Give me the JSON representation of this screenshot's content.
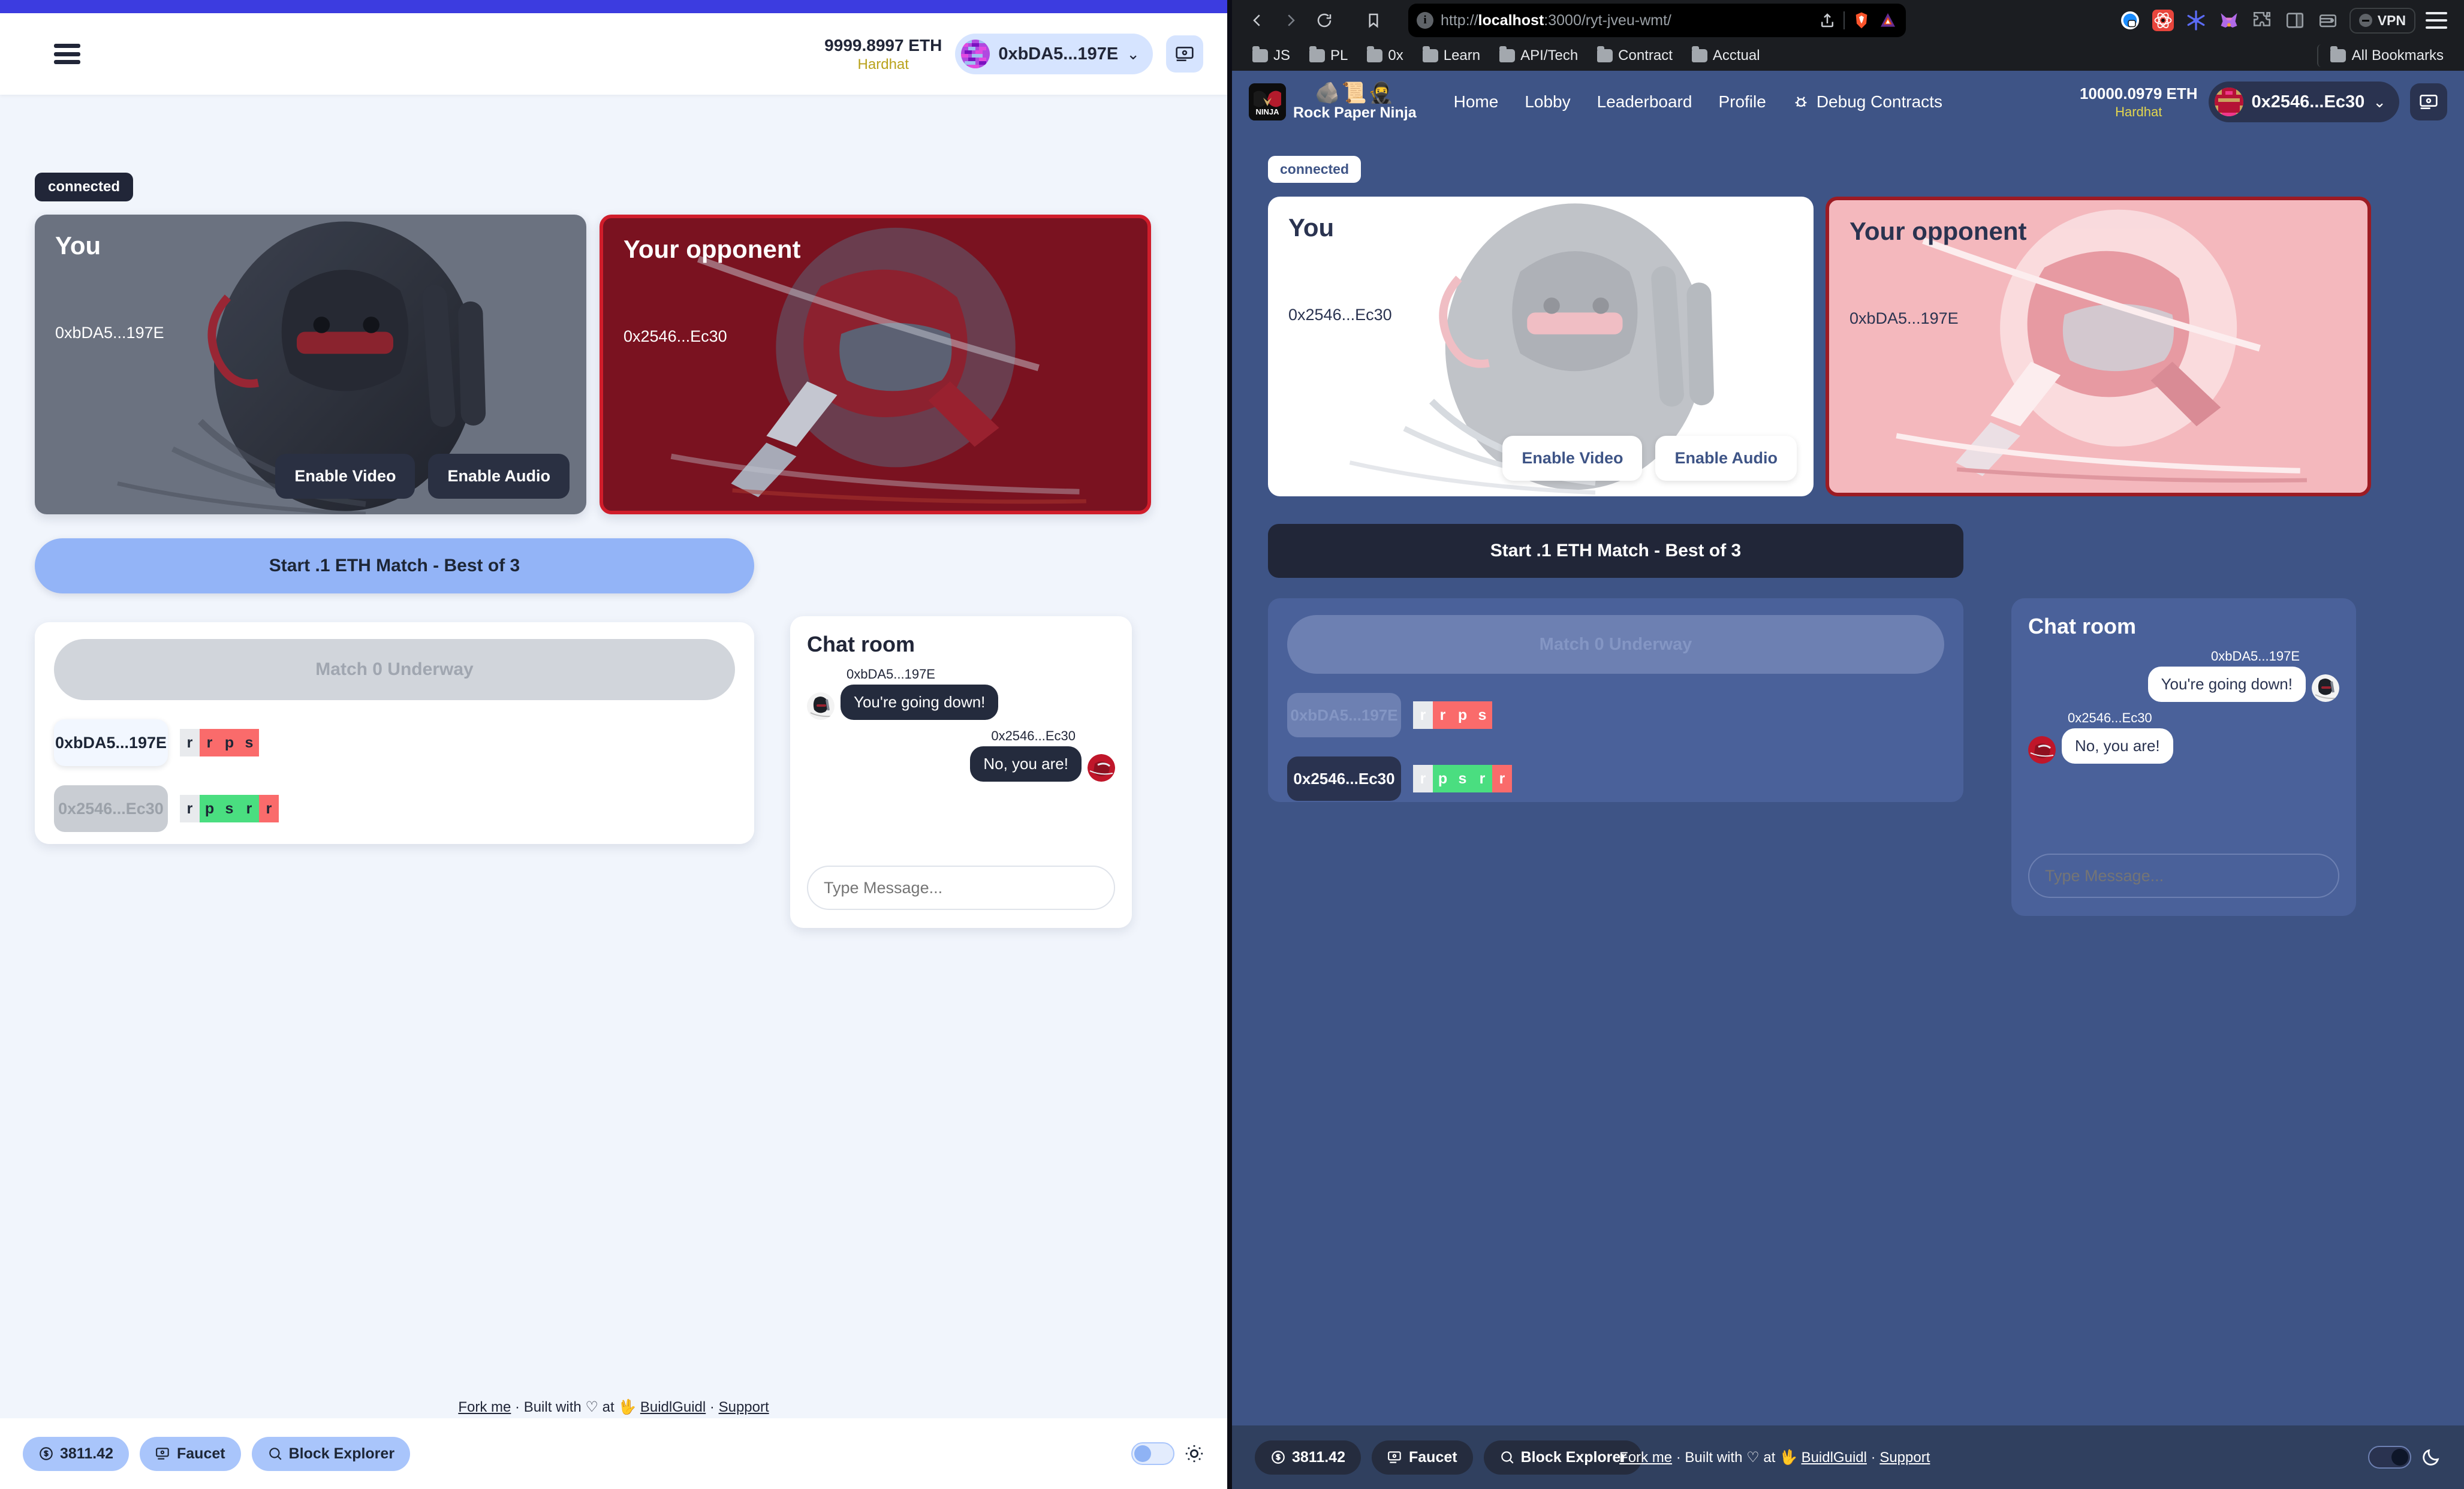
{
  "left_app": {
    "header": {
      "balance_eth": "9999.8997 ETH",
      "network": "Hardhat",
      "address": "0xbDA5...197E",
      "chevron": "chevron-down-icon",
      "menu_icon": "hamburger-menu-icon"
    },
    "status_badge": "connected",
    "you_card": {
      "title": "You",
      "address": "0xbDA5...197E",
      "enable_video": "Enable Video",
      "enable_audio": "Enable Audio"
    },
    "opponent_card": {
      "title": "Your opponent",
      "address": "0x2546...Ec30"
    },
    "start_button": "Start .1 ETH Match - Best of 3",
    "match": {
      "underway": "Match 0 Underway",
      "rows": [
        {
          "address": "0xbDA5...197E",
          "active": true,
          "moves": [
            {
              "m": "r",
              "state": "neutral"
            },
            {
              "m": "r",
              "state": "lose"
            },
            {
              "m": "p",
              "state": "lose"
            },
            {
              "m": "s",
              "state": "lose"
            }
          ]
        },
        {
          "address": "0x2546...Ec30",
          "active": false,
          "moves": [
            {
              "m": "r",
              "state": "neutral"
            },
            {
              "m": "p",
              "state": "win"
            },
            {
              "m": "s",
              "state": "win"
            },
            {
              "m": "r",
              "state": "win"
            },
            {
              "m": "r",
              "state": "lose"
            }
          ]
        }
      ]
    },
    "chat": {
      "title": "Chat room",
      "messages": [
        {
          "who": "0xbDA5...197E",
          "text": "You're going down!",
          "side": "left"
        },
        {
          "who": "0x2546...Ec30",
          "text": "No, you are!",
          "side": "right"
        }
      ],
      "input_placeholder": "Type Message..."
    },
    "footer": {
      "fork_me": "Fork me",
      "sep1": "·",
      "built_with": "Built with",
      "heart": "♡",
      "at": "at",
      "buidlguidl": "BuidlGuidl",
      "sep2": "·",
      "support": "Support",
      "price": "3811.42",
      "faucet": "Faucet",
      "block_explorer": "Block Explorer"
    }
  },
  "browser": {
    "back_icon": "back-arrow-icon",
    "forward_icon": "forward-arrow-icon",
    "reload_icon": "reload-icon",
    "bookmark_icon": "bookmark-icon",
    "url_prefix": "http://",
    "url_host": "localhost",
    "url_rest": ":3000/ryt-jveu-wmt/",
    "share_icon": "share-icon",
    "brave_icon": "brave-lion-icon",
    "bat_icon": "bat-triangle-icon",
    "extensions": [
      "1password-icon",
      "react-devtools-icon",
      "snowflake-icon",
      "metamask-fox-icon",
      "puzzle-extension-icon",
      "sidepanel-icon",
      "wallet-icon"
    ],
    "vpn_label": "VPN",
    "menu_icon": "hamburger-menu-icon",
    "bookmarks": [
      "JS",
      "PL",
      "0x",
      "Learn",
      "API/Tech",
      "Contract",
      "Acctual"
    ],
    "all_bookmarks": "All Bookmarks"
  },
  "right_app": {
    "brand": {
      "name": "Rock Paper Ninja",
      "emoji": "🪨📜🥷",
      "logo_text": "NINJA"
    },
    "nav": [
      "Home",
      "Lobby",
      "Leaderboard",
      "Profile"
    ],
    "debug_contracts": "Debug Contracts",
    "header": {
      "balance_eth": "10000.0979 ETH",
      "network": "Hardhat",
      "address": "0x2546...Ec30"
    },
    "status_badge": "connected",
    "you_card": {
      "title": "You",
      "address": "0x2546...Ec30",
      "enable_video": "Enable Video",
      "enable_audio": "Enable Audio"
    },
    "opponent_card": {
      "title": "Your opponent",
      "address": "0xbDA5...197E"
    },
    "start_button": "Start .1 ETH Match - Best of 3",
    "match": {
      "underway": "Match 0 Underway",
      "rows": [
        {
          "address": "0xbDA5...197E",
          "active": false,
          "moves": [
            {
              "m": "r",
              "state": "neutral"
            },
            {
              "m": "r",
              "state": "lose"
            },
            {
              "m": "p",
              "state": "lose"
            },
            {
              "m": "s",
              "state": "lose"
            }
          ]
        },
        {
          "address": "0x2546...Ec30",
          "active": true,
          "moves": [
            {
              "m": "r",
              "state": "neutral"
            },
            {
              "m": "p",
              "state": "win"
            },
            {
              "m": "s",
              "state": "win"
            },
            {
              "m": "r",
              "state": "win"
            },
            {
              "m": "r",
              "state": "lose"
            }
          ]
        }
      ]
    },
    "chat": {
      "title": "Chat room",
      "messages": [
        {
          "who": "0xbDA5...197E",
          "text": "You're going down!",
          "side": "right"
        },
        {
          "who": "0x2546...Ec30",
          "text": "No, you are!",
          "side": "left"
        }
      ],
      "input_placeholder": "Type Message..."
    },
    "footer": {
      "fork_me": "Fork me",
      "sep1": "·",
      "built_with": "Built with",
      "heart": "♡",
      "at": "at",
      "buidlguidl": "BuidlGuidl",
      "sep2": "·",
      "support": "Support",
      "price": "3811.42",
      "faucet": "Faucet",
      "block_explorer": "Block Explorer"
    }
  },
  "colors": {
    "left_accent": "#3c3ce0",
    "left_bg": "#f1f5fc",
    "right_app_bg": "#3e5486",
    "opponent_red": "#d01d2b",
    "win_green": "#4ade80",
    "lose_red": "#fa6b6b",
    "network_yellow": "#b9a21b"
  }
}
